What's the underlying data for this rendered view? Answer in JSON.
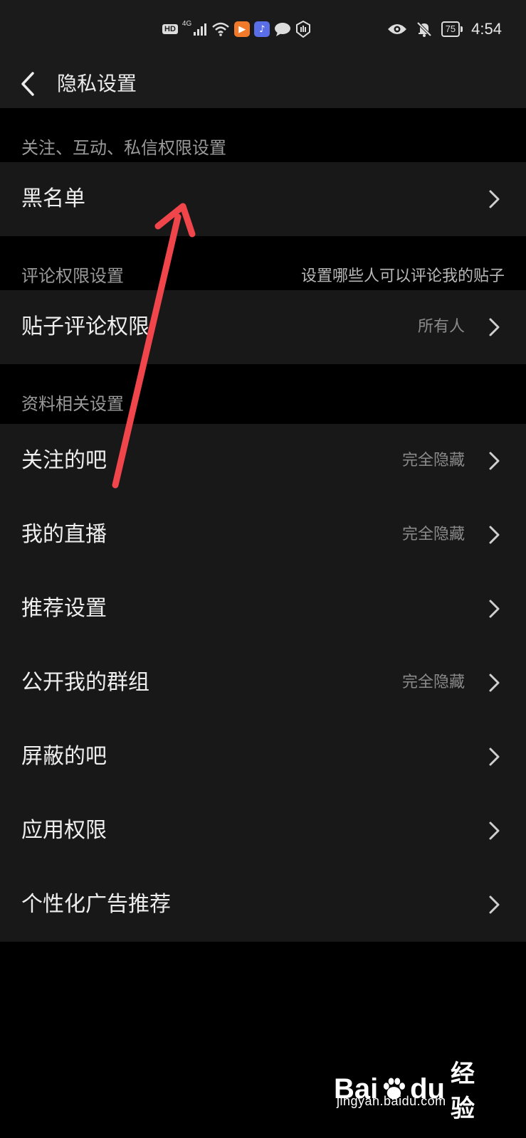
{
  "status_bar": {
    "hd": "HD",
    "network": "4G",
    "battery": "75",
    "time": "4:54",
    "icons": [
      "hd-icon",
      "signal-icon",
      "wifi-icon",
      "app-orange-icon",
      "app-music-icon",
      "message-icon",
      "hand-icon",
      "eye-icon",
      "mute-icon",
      "battery-icon"
    ]
  },
  "navbar": {
    "title": "隐私设置",
    "back_icon": "chevron-left-icon"
  },
  "sections": [
    {
      "title": "关注、互动、私信权限设置",
      "desc": "",
      "items": [
        {
          "label": "黑名单",
          "value": ""
        }
      ]
    },
    {
      "title": "评论权限设置",
      "desc": "设置哪些人可以评论我的贴子",
      "items": [
        {
          "label": "贴子评论权限",
          "value": "所有人"
        }
      ]
    },
    {
      "title": "资料相关设置",
      "desc": "",
      "items": [
        {
          "label": "关注的吧",
          "value": "完全隐藏"
        },
        {
          "label": "我的直播",
          "value": "完全隐藏"
        },
        {
          "label": "推荐设置",
          "value": ""
        },
        {
          "label": "公开我的群组",
          "value": "完全隐藏"
        },
        {
          "label": "屏蔽的吧",
          "value": ""
        },
        {
          "label": "应用权限",
          "value": ""
        },
        {
          "label": "个性化广告推荐",
          "value": ""
        }
      ]
    }
  ],
  "annotation": {
    "color": "#f0454b"
  },
  "watermark": {
    "brand_a": "Bai",
    "brand_b": "du",
    "jingyan": "经验",
    "url": "jingyan.baidu.com"
  },
  "colors": {
    "background": "#000000",
    "card": "#181818",
    "header": "#1b1b1b"
  }
}
